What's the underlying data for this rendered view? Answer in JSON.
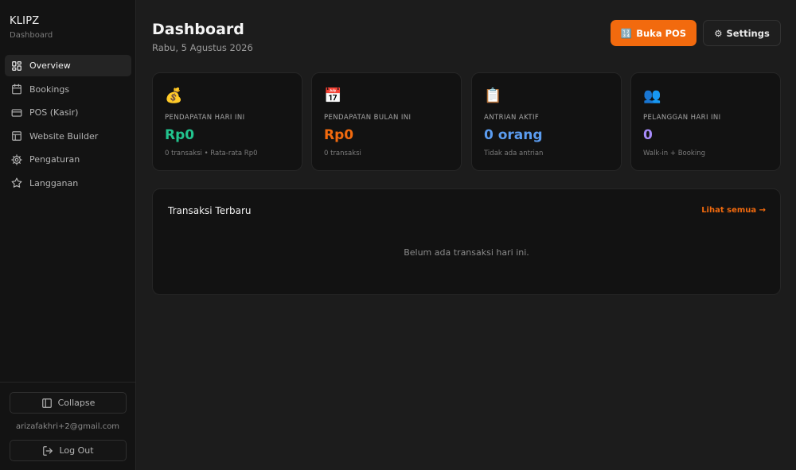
{
  "brand": {
    "name": "KLIPZ",
    "subtitle": "Dashboard"
  },
  "sidebar": {
    "items": [
      {
        "label": "Overview",
        "icon": "grid-icon",
        "active": true
      },
      {
        "label": "Bookings",
        "icon": "calendar-icon",
        "active": false
      },
      {
        "label": "POS (Kasir)",
        "icon": "credit-card-icon",
        "active": false
      },
      {
        "label": "Website Builder",
        "icon": "layout-icon",
        "active": false
      },
      {
        "label": "Pengaturan",
        "icon": "gear-icon",
        "active": false
      },
      {
        "label": "Langganan",
        "icon": "star-icon",
        "active": false
      }
    ],
    "collapse_label": "Collapse",
    "user_email": "arizafakhri+2@gmail.com",
    "logout_label": "Log Out"
  },
  "header": {
    "title": "Dashboard",
    "date": "Rabu, 5 Agustus 2026",
    "pos_button": {
      "icon": "🔢",
      "label": "Buka POS"
    },
    "settings_button": {
      "icon": "⚙",
      "label": "Settings"
    }
  },
  "stats": [
    {
      "icon": "💰",
      "label": "PENDAPATAN HARI INI",
      "value": "Rp0",
      "sub": "0 transaksi • Rata-rata Rp0",
      "color": "#22c38e"
    },
    {
      "icon": "📅",
      "label": "PENDAPATAN BULAN INI",
      "value": "Rp0",
      "sub": "0 transaksi",
      "color": "#f26a0e"
    },
    {
      "icon": "📋",
      "label": "ANTRIAN AKTIF",
      "value": "0 orang",
      "sub": "Tidak ada antrian",
      "color": "#5b9cf0"
    },
    {
      "icon": "👥",
      "label": "PELANGGAN HARI INI",
      "value": "0",
      "sub": "Walk-in + Booking",
      "color": "#a78bfa"
    }
  ],
  "recent": {
    "title": "Transaksi Terbaru",
    "link": "Lihat semua →",
    "empty": "Belum ada transaksi hari ini."
  },
  "colors": {
    "accent": "#f26a0e",
    "background": "#1c1c1c",
    "sidebar": "#131313",
    "card": "#121212"
  }
}
